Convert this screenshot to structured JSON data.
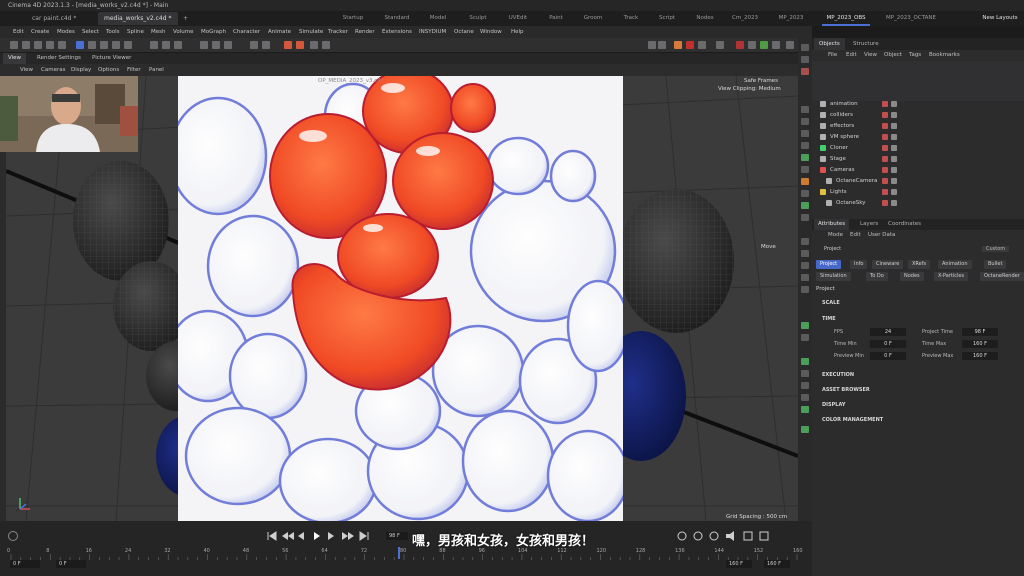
{
  "window": {
    "title": "Cinema 4D 2023.1.3 - [media_works_v2.c4d *] - Main"
  },
  "file_tabs": [
    {
      "label": "car paint.c4d *"
    },
    {
      "label": "media_works_v2.c4d *"
    },
    {
      "label": "+"
    }
  ],
  "layout_tabs": [
    {
      "label": "Startup"
    },
    {
      "label": "Standard"
    },
    {
      "label": "Model"
    },
    {
      "label": "Sculpt"
    },
    {
      "label": "UVEdit"
    },
    {
      "label": "Paint"
    },
    {
      "label": "Groom"
    },
    {
      "label": "Track"
    },
    {
      "label": "Script"
    },
    {
      "label": "Nodes"
    },
    {
      "label": "Cm_2023"
    },
    {
      "label": "MP_2023"
    },
    {
      "label": "MP_2023_OBS"
    },
    {
      "label": "MP_2023_OCTANE"
    }
  ],
  "new_layouts_label": "New Layouts",
  "main_menu": [
    {
      "label": "Edit"
    },
    {
      "label": "Create"
    },
    {
      "label": "Modes"
    },
    {
      "label": "Select"
    },
    {
      "label": "Tools"
    },
    {
      "label": "Spline"
    },
    {
      "label": "Mesh"
    },
    {
      "label": "Volume"
    },
    {
      "label": "MoGraph"
    },
    {
      "label": "Character"
    },
    {
      "label": "Animate"
    },
    {
      "label": "Simulate"
    },
    {
      "label": "Tracker"
    },
    {
      "label": "Render"
    },
    {
      "label": "Extensions"
    },
    {
      "label": "INSYDIUM"
    },
    {
      "label": "Octane"
    },
    {
      "label": "Window"
    },
    {
      "label": "Help"
    }
  ],
  "view_tabs": [
    {
      "label": "View"
    },
    {
      "label": "Render Settings"
    },
    {
      "label": "Picture Viewer"
    }
  ],
  "view_menu": [
    {
      "label": "View"
    },
    {
      "label": "Cameras"
    },
    {
      "label": "Display"
    },
    {
      "label": "Options"
    },
    {
      "label": "Filter"
    },
    {
      "label": "Panel"
    }
  ],
  "viewport": {
    "safe_frames": "Safe Frames",
    "view_clipping": "View Clipping: Medium",
    "move_label": "Move",
    "grid_spacing": "Grid Spacing : 500 cm",
    "render_overlay": "OP_MEDIA_2023_v3.c4d"
  },
  "subtitle": "嘿，男孩和女孩，女孩和男孩！",
  "timeline": {
    "current_frame": "98 F",
    "ticks": [
      "0",
      "8",
      "16",
      "24",
      "32",
      "40",
      "48",
      "56",
      "64",
      "72",
      "80",
      "88",
      "96",
      "104",
      "112",
      "120",
      "128",
      "136",
      "144",
      "152",
      "160"
    ],
    "start_field": "0 F",
    "start_field2": "0 F",
    "end_field": "160 F",
    "end_field2": "160 F"
  },
  "objects_panel": {
    "tabs": [
      {
        "label": "Objects"
      },
      {
        "label": "Structure"
      }
    ],
    "menu": [
      {
        "label": "File"
      },
      {
        "label": "Edit"
      },
      {
        "label": "View"
      },
      {
        "label": "Object"
      },
      {
        "label": "Tags"
      },
      {
        "label": "Bookmarks"
      }
    ],
    "items": [
      {
        "name": "animation",
        "indent": 0,
        "color": "#b0b0b0"
      },
      {
        "name": "colliders",
        "indent": 0,
        "color": "#b0b0b0"
      },
      {
        "name": "effectors",
        "indent": 0,
        "color": "#b0b0b0"
      },
      {
        "name": "VM sphere",
        "indent": 0,
        "color": "#b0b0b0"
      },
      {
        "name": "Cloner",
        "indent": 0,
        "color": "#3fd16a"
      },
      {
        "name": "Stage",
        "indent": 0,
        "color": "#b0b0b0"
      },
      {
        "name": "Cameras",
        "indent": 0,
        "color": "#e05050"
      },
      {
        "name": "OctaneCamera",
        "indent": 1,
        "color": "#b0b0b0"
      },
      {
        "name": "Lights",
        "indent": 0,
        "color": "#e0c040"
      },
      {
        "name": "OctaneSky",
        "indent": 1,
        "color": "#b0b0b0"
      }
    ]
  },
  "attributes_panel": {
    "tabs": [
      {
        "label": "Attributes"
      },
      {
        "label": "Layers"
      },
      {
        "label": "Coordinates"
      }
    ],
    "menu": [
      {
        "label": "Mode"
      },
      {
        "label": "Edit"
      },
      {
        "label": "User Data"
      }
    ],
    "object_label": "Project",
    "custom_label": "Custom",
    "buttons_row1": [
      {
        "label": "Project",
        "active": true
      },
      {
        "label": "Info"
      },
      {
        "label": "Cineware"
      },
      {
        "label": "XRefs"
      },
      {
        "label": "Animation"
      },
      {
        "label": "Bullet"
      }
    ],
    "buttons_row2": [
      {
        "label": "Simulation"
      },
      {
        "label": "To Do"
      },
      {
        "label": "Nodes"
      },
      {
        "label": "X-Particles"
      },
      {
        "label": "OctaneRender"
      }
    ],
    "heading": "Project",
    "sections": {
      "scale": "SCALE",
      "time": "TIME",
      "execution": "EXECUTION",
      "asset_browser": "ASSET BROWSER",
      "display": "DISPLAY",
      "color_management": "COLOR MANAGEMENT"
    },
    "time_fields": {
      "fps_label": "FPS",
      "fps": "24",
      "project_time_label": "Project Time",
      "project_time": "98 F",
      "time_min_label": "Time Min",
      "time_min": "0 F",
      "time_max_label": "Time Max",
      "time_max": "160 F",
      "preview_min_label": "Preview Min",
      "preview_min": "0 F",
      "preview_max_label": "Preview Max",
      "preview_max": "160 F"
    }
  }
}
